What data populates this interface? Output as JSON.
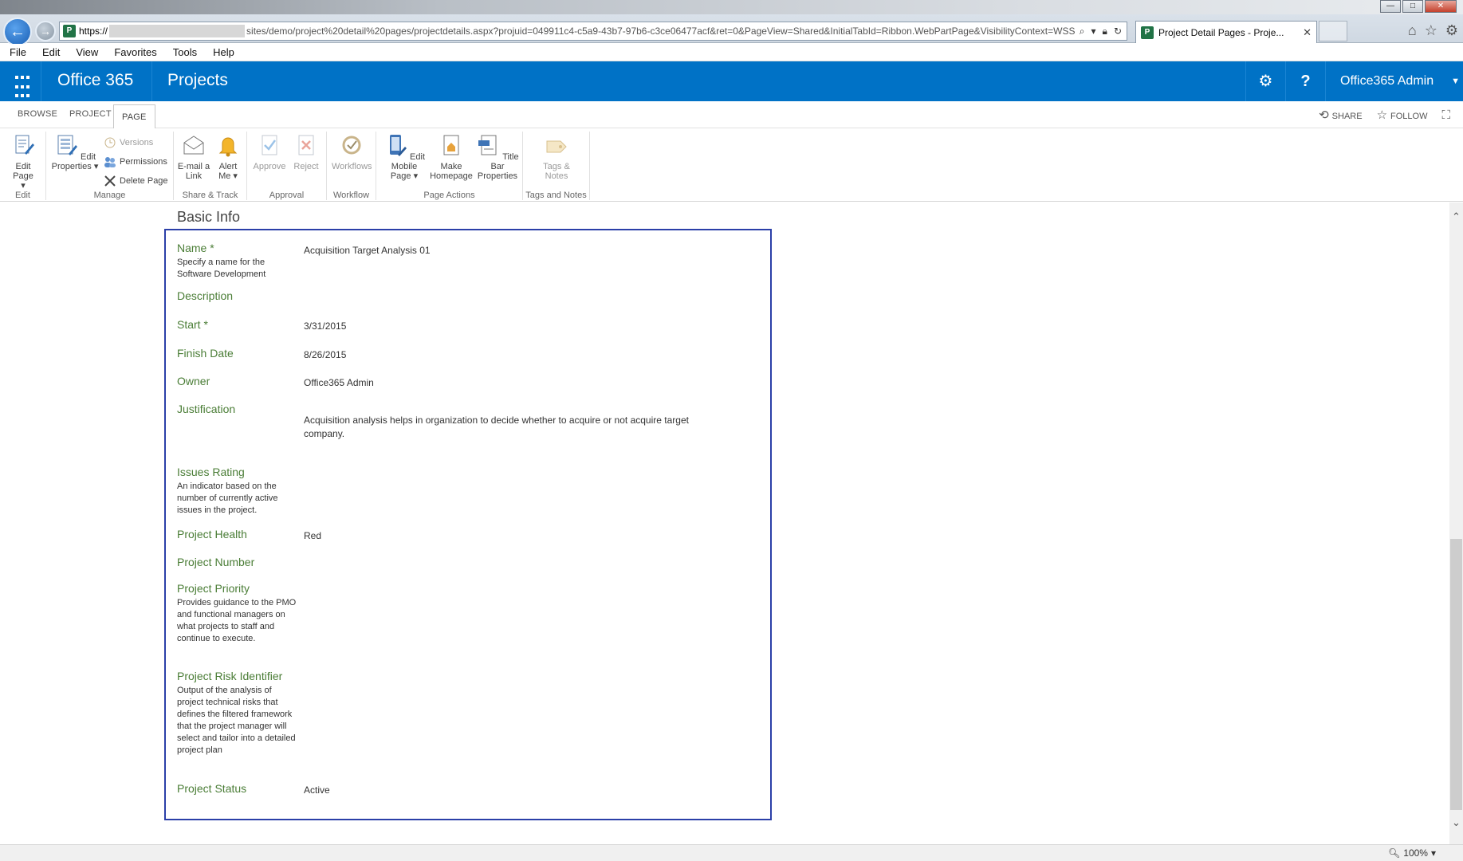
{
  "browser": {
    "url_prefix": "https://",
    "url_rest": "sites/demo/project%20detail%20pages/projectdetails.aspx?projuid=049911c4-c5a9-43b7-97b6-c3ce06477acf&ret=0&PageView=Shared&InitialTabId=Ribbon.WebPartPage&VisibilityContext=WSSW",
    "tab_title": "Project Detail Pages - Proje...",
    "tab_close": "✕",
    "menu": [
      "File",
      "Edit",
      "View",
      "Favorites",
      "Tools",
      "Help"
    ]
  },
  "suite": {
    "brand": "Office 365",
    "app": "Projects",
    "gear": "⚙",
    "help": "?",
    "user": "Office365 Admin"
  },
  "ribbon": {
    "tabs": [
      "BROWSE",
      "PROJECT",
      "PAGE"
    ],
    "share": "SHARE",
    "follow": "FOLLOW",
    "groups": {
      "edit": "Edit",
      "manage": "Manage",
      "share_track": "Share & Track",
      "approval": "Approval",
      "workflow": "Workflow",
      "page_actions": "Page Actions",
      "tags_notes": "Tags and Notes"
    },
    "buttons": {
      "edit_page": "Edit Page",
      "edit_properties": "Edit Properties",
      "versions": "Versions",
      "permissions": "Permissions",
      "delete_page": "Delete Page",
      "email_link": "E-mail a Link",
      "alert_me": "Alert Me",
      "approve": "Approve",
      "reject": "Reject",
      "workflows": "Workflows",
      "edit_mobile_page": "Edit Mobile Page",
      "make_homepage": "Make Homepage",
      "title_bar_properties": "Title Bar Properties",
      "tags_notes": "Tags & Notes"
    }
  },
  "form": {
    "section_title": "Basic Info",
    "fields": [
      {
        "label": "Name *",
        "desc": "Specify a name for the Software Development",
        "value": "Acquisition Target Analysis 01"
      },
      {
        "label": "Description",
        "desc": "",
        "value": ""
      },
      {
        "label": "Start *",
        "desc": "",
        "value": "3/31/2015"
      },
      {
        "label": "Finish Date",
        "desc": "",
        "value": "8/26/2015"
      },
      {
        "label": "Owner",
        "desc": "",
        "value": "Office365 Admin"
      },
      {
        "label": "Justification",
        "desc": "",
        "value": "Acquisition analysis helps in organization to decide whether to acquire or not acquire target company."
      },
      {
        "label": "Issues Rating",
        "desc": "An indicator based on the number of currently active issues in the project.",
        "value": ""
      },
      {
        "label": "Project Health",
        "desc": "",
        "value": "Red"
      },
      {
        "label": "Project Number",
        "desc": "",
        "value": ""
      },
      {
        "label": "Project Priority",
        "desc": "Provides guidance to the PMO and functional managers on what projects to staff and continue to execute.",
        "value": ""
      },
      {
        "label": "Project Risk Identifier",
        "desc": "Output of the analysis of project technical risks that defines the filtered framework that the project manager will select and tailor into a detailed project plan",
        "value": ""
      },
      {
        "label": "Project Status",
        "desc": "",
        "value": "Active"
      }
    ]
  },
  "status_bar": {
    "zoom": "100%"
  }
}
